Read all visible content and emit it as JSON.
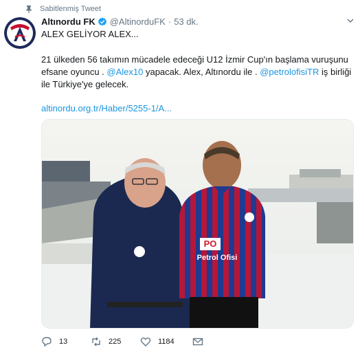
{
  "pinned": {
    "label": "Sabitlenmiş Tweet",
    "icon": "pin-icon"
  },
  "tweet": {
    "name": "Altınordu FK",
    "handle": "@AltinorduFK",
    "separator": "·",
    "time": "53 dk.",
    "line1": "ALEX GELİYOR ALEX...",
    "para_part1": "21 ülkeden 56 takımın mücadele edeceği U12 İzmir Cup'ın başlama vuruşunu efsane oyuncu . ",
    "mention1": "@Alex10",
    "para_part2": " yapacak.  Alex, Altınordu ile . ",
    "mention2": "@petrolofisiTR",
    "para_part3": " iş birliği ile Türkiye'ye gelecek.",
    "url": "altinordu.org.tr/Haber/5255-1/A..."
  },
  "photo_jersey_text": "Petrol Ofisi",
  "actions": {
    "reply_count": "13",
    "retweet_count": "225",
    "like_count": "1184"
  },
  "colors": {
    "link": "#1b95e0",
    "muted": "#657786",
    "verified": "#1da1f2"
  }
}
